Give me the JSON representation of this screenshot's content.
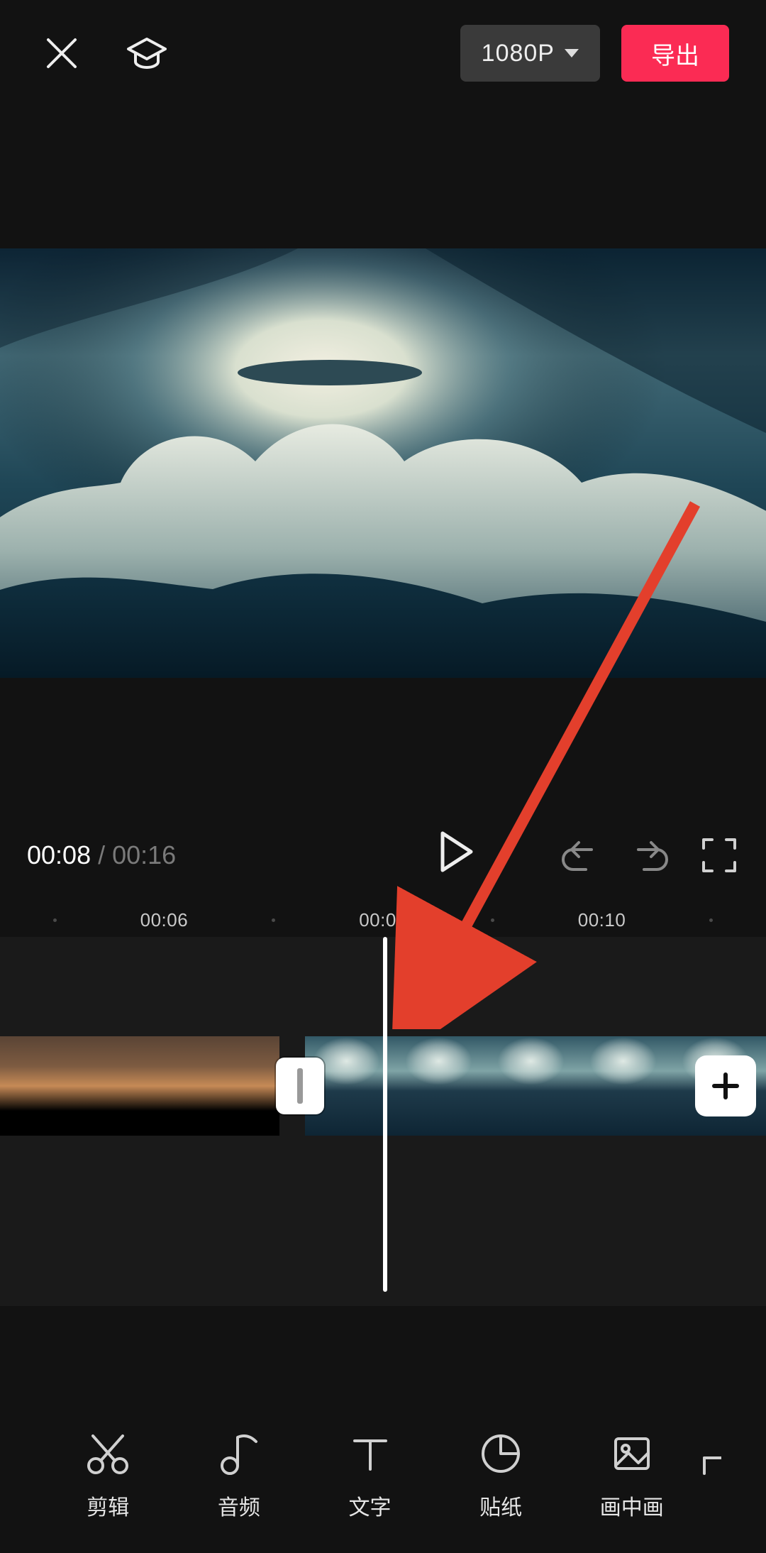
{
  "topbar": {
    "resolution_label": "1080P",
    "export_label": "导出"
  },
  "playback": {
    "current_time": "00:08",
    "separator": "/",
    "total_time": "00:16"
  },
  "ruler": {
    "labels": [
      "00:06",
      "00:08",
      "00:10"
    ]
  },
  "tools": [
    {
      "id": "edit",
      "label": "剪辑",
      "icon": "scissors"
    },
    {
      "id": "audio",
      "label": "音频",
      "icon": "music-note"
    },
    {
      "id": "text",
      "label": "文字",
      "icon": "text-t"
    },
    {
      "id": "sticker",
      "label": "贴纸",
      "icon": "sticker"
    },
    {
      "id": "pip",
      "label": "画中画",
      "icon": "image"
    }
  ],
  "annotation": {
    "type": "arrow",
    "color": "#e33f2c",
    "description": "red arrow pointing from upper-right of preview down toward transition gap on timeline"
  }
}
